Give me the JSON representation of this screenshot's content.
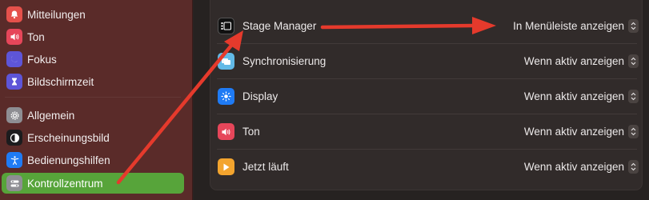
{
  "sidebar": {
    "items": [
      {
        "label": "Mitteilungen",
        "icon": "bell-icon",
        "color": "#e5514b"
      },
      {
        "label": "Ton",
        "icon": "speaker-icon",
        "color": "#e6465a"
      },
      {
        "label": "Fokus",
        "icon": "moon-icon",
        "color": "#5e55d8"
      },
      {
        "label": "Bildschirmzeit",
        "icon": "hourglass-icon",
        "color": "#5e55d8"
      },
      {
        "label": "Allgemein",
        "icon": "gear-icon",
        "color": "#8e8e93"
      },
      {
        "label": "Erscheinungsbild",
        "icon": "appearance-icon",
        "color": "#1c1c1e"
      },
      {
        "label": "Bedienungshilfen",
        "icon": "accessibility-icon",
        "color": "#1f7bf5"
      },
      {
        "label": "Kontrollzentrum",
        "icon": "control-center-icon",
        "color": "#8e8e93",
        "active": true
      }
    ]
  },
  "settings": {
    "rows": [
      {
        "label": "Stage Manager",
        "value": "In Menüleiste anzeigen",
        "icon": "stage-manager-icon",
        "color": "#111111"
      },
      {
        "label": "Synchronisierung",
        "value": "Wenn aktiv anzeigen",
        "icon": "sync-icon",
        "color": "#62b9e6"
      },
      {
        "label": "Display",
        "value": "Wenn aktiv anzeigen",
        "icon": "brightness-icon",
        "color": "#1f7bf5"
      },
      {
        "label": "Ton",
        "value": "Wenn aktiv anzeigen",
        "icon": "speaker-icon",
        "color": "#e6465a"
      },
      {
        "label": "Jetzt läuft",
        "value": "Wenn aktiv anzeigen",
        "icon": "play-icon",
        "color": "#f3a42e"
      }
    ]
  },
  "colors": {
    "sidebar_bg": "#5a2b29",
    "active_bg": "#57a43a",
    "arrow": "#e53a2c"
  }
}
